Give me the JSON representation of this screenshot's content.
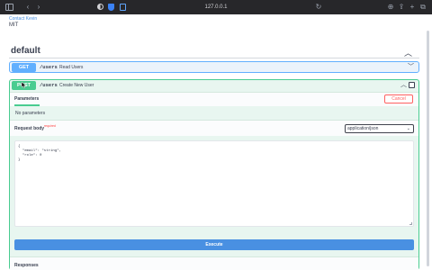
{
  "browser": {
    "url": "127.0.0.1"
  },
  "info": {
    "contact_link": "Contact Kevin",
    "license": "MIT"
  },
  "tag": {
    "title": "default"
  },
  "operations": {
    "get": {
      "method": "GET",
      "path": "/users",
      "summary": "Read Users"
    },
    "post": {
      "method": "POST",
      "path": "/users",
      "summary": "Create New User",
      "parameters_title": "Parameters",
      "cancel_label": "Cancel",
      "no_parameters": "No parameters",
      "request_body_label": "Request body",
      "required_label": "required",
      "content_type": "application/json",
      "body_text": "{\n  \"email\": \"string\",\n  \"role\": 0\n}",
      "execute_label": "Execute",
      "responses_label": "Responses"
    }
  },
  "icons": {
    "sidebar": "sidebar-toggle-icon",
    "back": "back-arrow-icon",
    "forward": "forward-arrow-icon",
    "privacy": "half-moon-icon",
    "shield": "shield-icon",
    "extension": "extension-icon",
    "refresh": "refresh-icon",
    "download": "download-icon",
    "share": "share-icon",
    "add_tab": "plus-icon",
    "tabs": "tabs-overview-icon",
    "collapse": "chevron-up-icon",
    "expand": "chevron-down-icon",
    "lock": "lock-icon"
  },
  "colors": {
    "get": "#61affe",
    "post": "#49cc90",
    "execute": "#4990e2",
    "cancel": "#ff6060"
  }
}
